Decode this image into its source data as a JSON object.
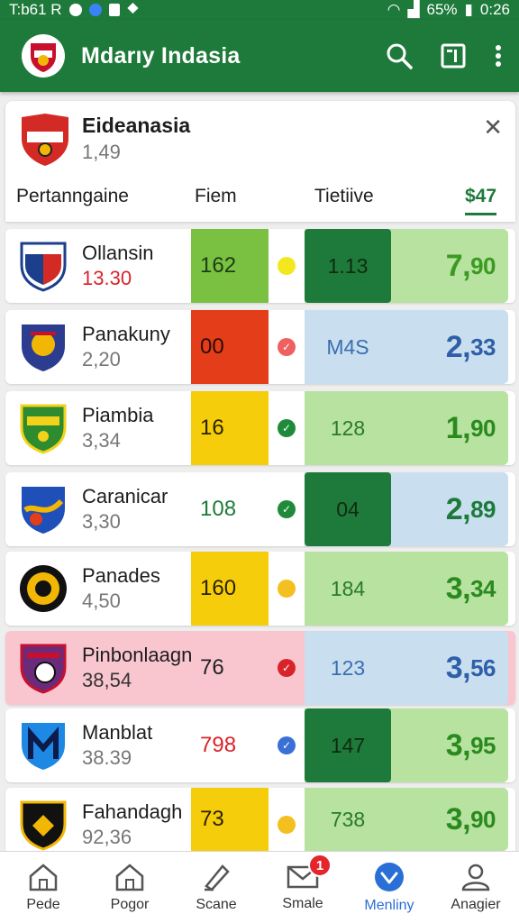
{
  "status_bar": {
    "left_text": "T:b61 R",
    "battery": "65%",
    "time": "0:26"
  },
  "app_bar": {
    "title": "Mdarıy Indasia"
  },
  "header_card": {
    "team_name": "Eideanasia",
    "team_value": "1,49",
    "tabs": [
      "Pertanngaine",
      "Fiem",
      "Tietiive",
      "$47"
    ]
  },
  "colors": {
    "primary_green": "#1e7a3a",
    "bright_green": "#7ac142",
    "dark_green": "#1e7a3a",
    "light_green": "#b7e2a0",
    "light_blue": "#c9dff0",
    "red": "#e43d1a",
    "yellow": "#f6cd0a",
    "pink": "#f9c6d0"
  },
  "rows": [
    {
      "team": "Ollansin",
      "value": "13.30",
      "c1": "162",
      "c2": "1.13",
      "c3a": "7,",
      "c3b": "90"
    },
    {
      "team": "Panakuny",
      "value": "2,20",
      "c1": "00",
      "c2": "M4S",
      "c3a": "2,",
      "c3b": "33"
    },
    {
      "team": "Piambia",
      "value": "3,34",
      "c1": "16",
      "c2": "128",
      "c3a": "1,",
      "c3b": "90"
    },
    {
      "team": "Caranicar",
      "value": "3,30",
      "c1": "108",
      "c2": "04",
      "c3a": "2,",
      "c3b": "89"
    },
    {
      "team": "Panades",
      "value": "4,50",
      "c1": "160",
      "c2": "184",
      "c3a": "3,",
      "c3b": "34"
    },
    {
      "team": "Pinbonlaagn",
      "value": "38,54",
      "c1": "76",
      "c2": "123",
      "c3a": "3,",
      "c3b": "56"
    },
    {
      "team": "Manblat",
      "value": "38.39",
      "c1": "798",
      "c2": "147",
      "c3a": "3,",
      "c3b": "95"
    },
    {
      "team": "Fahandagh",
      "value": "92,36",
      "c1": "73",
      "c2": "738",
      "c3a": "3,",
      "c3b": "90"
    }
  ],
  "bottom_nav": {
    "items": [
      {
        "label": "Pede",
        "icon": "home-icon"
      },
      {
        "label": "Pogor",
        "icon": "home-icon"
      },
      {
        "label": "Scane",
        "icon": "scan-icon"
      },
      {
        "label": "Smale",
        "icon": "mail-icon",
        "badge": "1"
      },
      {
        "label": "Menliny",
        "icon": "heart-icon"
      },
      {
        "label": "Anagier",
        "icon": "person-icon"
      }
    ]
  }
}
